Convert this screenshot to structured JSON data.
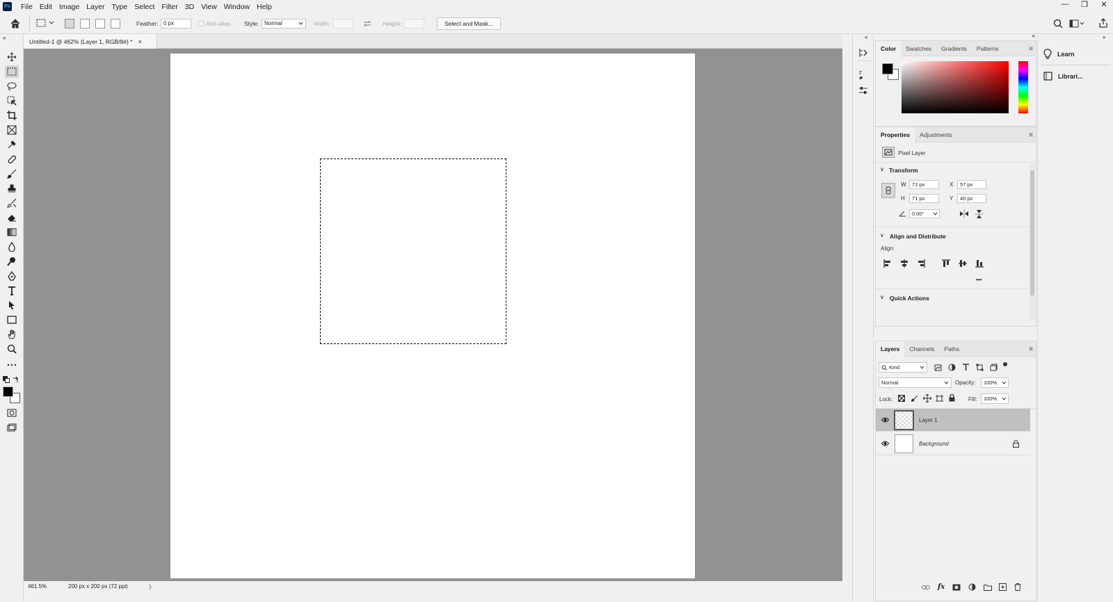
{
  "app": {
    "logo": "Ps"
  },
  "menu": [
    "File",
    "Edit",
    "Image",
    "Layer",
    "Type",
    "Select",
    "Filter",
    "3D",
    "View",
    "Window",
    "Help"
  ],
  "window_controls": {
    "minimize": "—",
    "restore": "❐",
    "close": "✕"
  },
  "options": {
    "feather_label": "Feather:",
    "feather_value": "0 px",
    "anti_alias_label": "Anti-alias",
    "style_label": "Style:",
    "style_value": "Normal",
    "width_label": "Width:",
    "height_label": "Height:",
    "select_mask_label": "Select and Mask..."
  },
  "document": {
    "tab_title": "Untitled-1 @ 462% (Layer 1, RGB/8#) *",
    "tab_close": "×"
  },
  "status": {
    "zoom": "461.5%",
    "doc_info": "200 px x 200 px (72 ppi)",
    "arrow": "〉"
  },
  "right_sidebar": {
    "learn": "Learn",
    "libraries": "Librari..."
  },
  "color_panel": {
    "tabs": [
      "Color",
      "Swatches",
      "Gradients",
      "Patterns"
    ],
    "foreground": "#000000",
    "background": "#ffffff",
    "hue_color": "#ff0000"
  },
  "properties_panel": {
    "tabs": [
      "Properties",
      "Adjustments"
    ],
    "layer_type": "Pixel Layer",
    "transform_title": "Transform",
    "w_label": "W",
    "w_value": "71 px",
    "h_label": "H",
    "h_value": "71 px",
    "x_label": "X",
    "x_value": "57 px",
    "y_label": "Y",
    "y_value": "40 px",
    "angle_value": "0.00°",
    "align_title": "Align and Distribute",
    "align_label": "Align:",
    "more": "•••",
    "quick_actions_title": "Quick Actions"
  },
  "layers_panel": {
    "tabs": [
      "Layers",
      "Channels",
      "Paths"
    ],
    "kind_label": "Kind",
    "blend_mode": "Normal",
    "opacity_label": "Opacity:",
    "opacity_value": "100%",
    "lock_label": "Lock:",
    "fill_label": "Fill:",
    "fill_value": "100%",
    "layers": [
      {
        "name": "Layer 1",
        "selected": true,
        "locked": false
      },
      {
        "name": "Background",
        "selected": false,
        "locked": true
      }
    ]
  }
}
